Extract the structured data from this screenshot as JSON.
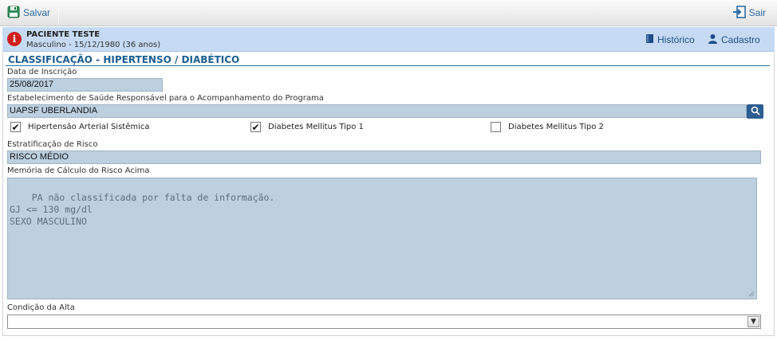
{
  "toolbar": {
    "save_label": "Salvar",
    "exit_label": "Sair",
    "save_icon": "save-icon",
    "exit_icon": "exit-icon"
  },
  "patient": {
    "name": "PACIENTE TESTE",
    "info": "Masculino - 15/12/1980 (36 anos)",
    "history_label": "Histórico",
    "register_label": "Cadastro",
    "alert_icon": "info-alert-icon"
  },
  "form": {
    "title": "CLASSIFICAÇÃO - HIPERTENSO / DIABÉTICO",
    "inscription": {
      "label": "Data de Inscrição",
      "value": "25/08/2017"
    },
    "establishment": {
      "label": "Estabelecimento de Saúde Responsável para o Acompanhamento do Programa",
      "value": "UAPSF UBERLANDIA"
    },
    "conditions": [
      {
        "label": "Hipertensão Arterial Sistêmica",
        "checked": "✔"
      },
      {
        "label": "Diabetes Mellitus Tipo 1",
        "checked": "✔"
      },
      {
        "label": "Diabetes Mellitus Tipo 2",
        "checked": ""
      }
    ],
    "risk": {
      "label": "Estratificação de Risco",
      "value": "RISCO MÉDIO"
    },
    "memo": {
      "label": "Memória de Cálculo do Risco Acima",
      "text": "PA não classificada por falta de informação.\nGJ <= 130 mg/dl\nSEXO MASCULINO"
    },
    "discharge": {
      "label": "Condição da Alta",
      "value": ""
    }
  },
  "colors": {
    "accent": "#2b6aa3",
    "patient_bar": "#c6dbf3",
    "field_bg": "#bdd0e0",
    "alert": "#cf1f1f"
  }
}
